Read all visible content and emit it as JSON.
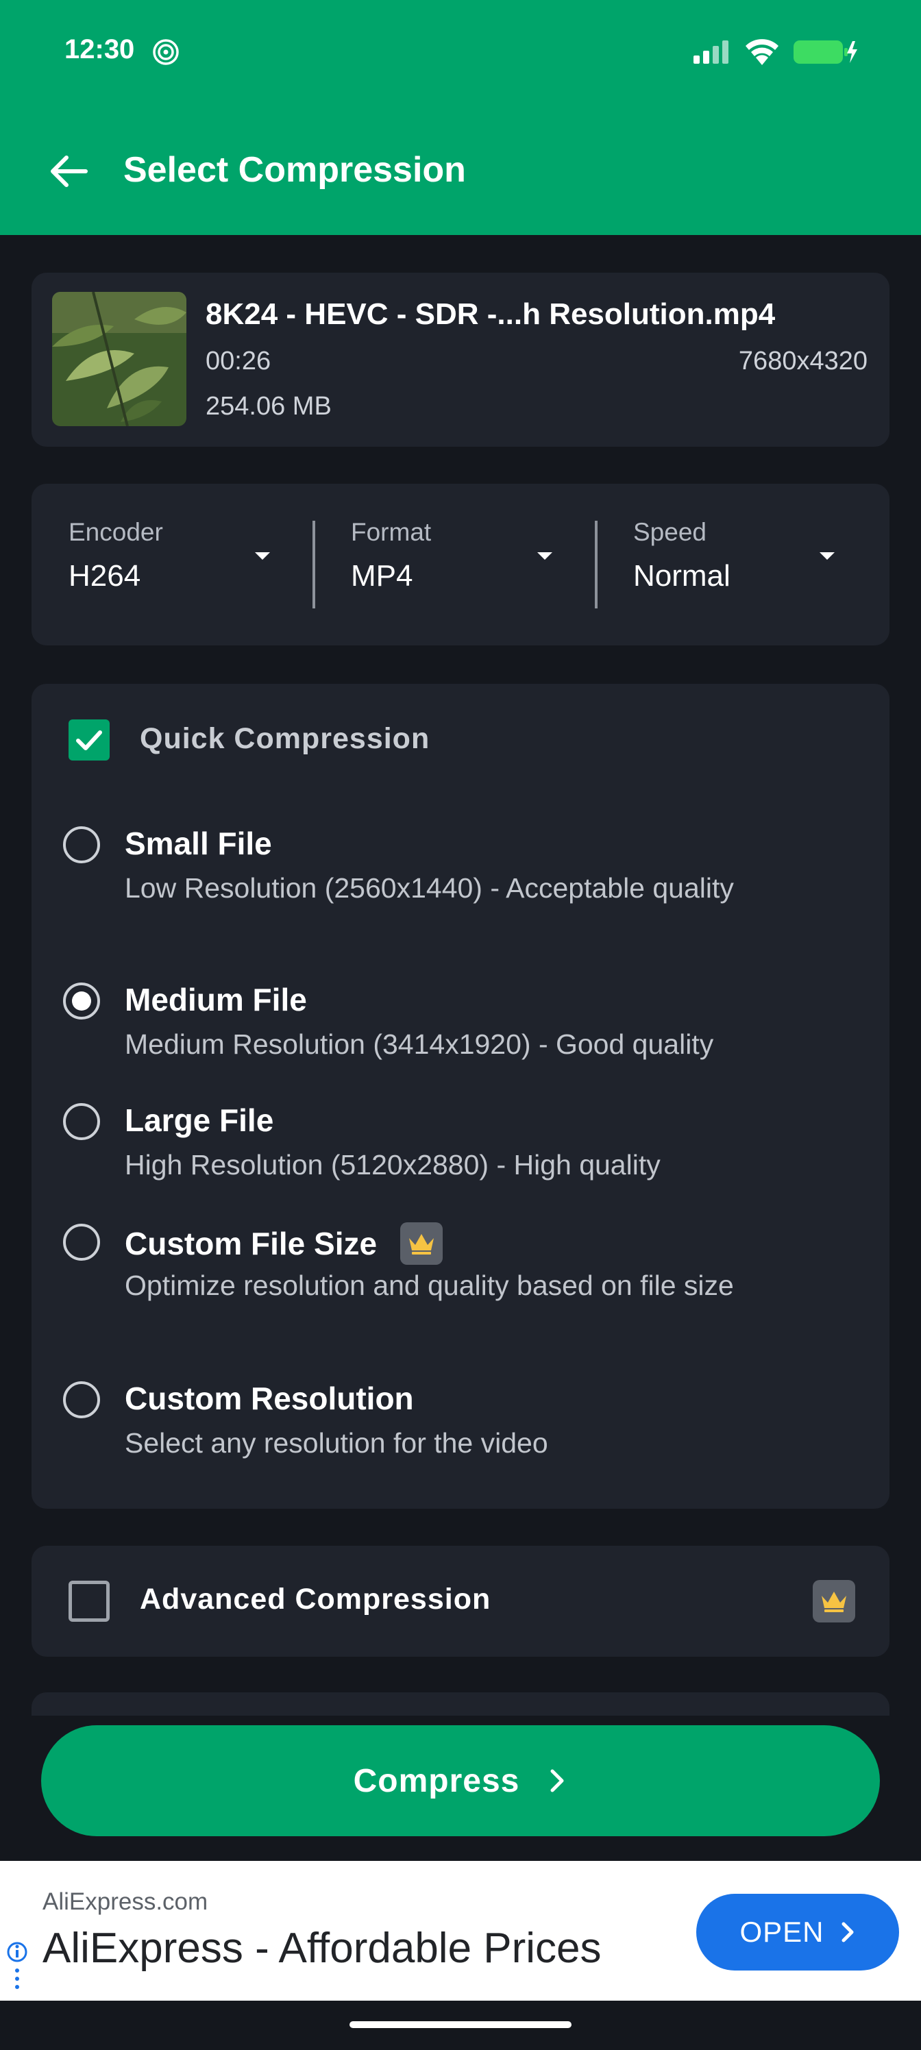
{
  "status_bar": {
    "time": "12:30",
    "icons": [
      "hotspot-icon",
      "signal-icon",
      "wifi-icon",
      "battery-charging-icon"
    ]
  },
  "header": {
    "title": "Select Compression",
    "back_icon": "arrow-left-icon"
  },
  "file": {
    "name": "8K24 - HEVC - SDR -...h Resolution.mp4",
    "duration": "00:26",
    "resolution": "7680x4320",
    "size": "254.06 MB"
  },
  "settings": [
    {
      "label": "Encoder",
      "value": "H264"
    },
    {
      "label": "Format",
      "value": "MP4"
    },
    {
      "label": "Speed",
      "value": "Normal"
    }
  ],
  "quick_compression": {
    "label": "Quick Compression",
    "checked": true,
    "options": [
      {
        "title": "Small File",
        "description": "Low Resolution (2560x1440) - Acceptable quality",
        "selected": false,
        "premium": false
      },
      {
        "title": "Medium File",
        "description": "Medium Resolution (3414x1920) - Good quality",
        "selected": true,
        "premium": false
      },
      {
        "title": "Large File",
        "description": "High Resolution (5120x2880) - High quality",
        "selected": false,
        "premium": false
      },
      {
        "title": "Custom File Size",
        "description": "Optimize resolution and quality based on file size",
        "selected": false,
        "premium": true
      },
      {
        "title": "Custom Resolution",
        "description": "Select any resolution for the video",
        "selected": false,
        "premium": false
      }
    ]
  },
  "advanced_compression": {
    "label": "Advanced Compression",
    "checked": false,
    "premium": true
  },
  "compress_button": {
    "label": "Compress"
  },
  "ad": {
    "source": "AliExpress.com",
    "headline": "AliExpress - Affordable Prices",
    "cta": "OPEN"
  },
  "colors": {
    "accent": "#00a46a",
    "background": "#14171d",
    "card": "#1f232c",
    "crown": "#f6c343",
    "ad_button": "#1a73e8"
  }
}
